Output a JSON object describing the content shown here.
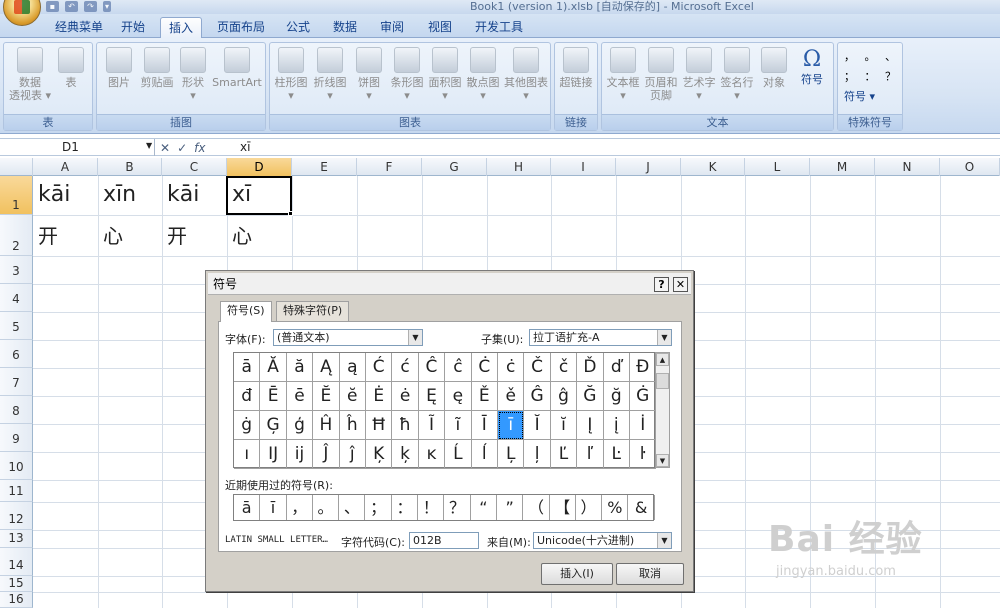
{
  "window": {
    "title": "Book1 (version 1).xlsb [自动保存的] - Microsoft Excel"
  },
  "tabs": [
    "经典菜单",
    "开始",
    "插入",
    "页面布局",
    "公式",
    "数据",
    "审阅",
    "视图",
    "开发工具"
  ],
  "active_tab": "插入",
  "ribbon": {
    "groups": [
      {
        "label": "表",
        "buttons": [
          "数据\n透视表 ▾",
          "表"
        ]
      },
      {
        "label": "插图",
        "buttons": [
          "图片",
          "剪贴画",
          "形状\n▾",
          "SmartArt"
        ]
      },
      {
        "label": "图表",
        "buttons": [
          "柱形图\n▾",
          "折线图\n▾",
          "饼图\n▾",
          "条形图\n▾",
          "面积图\n▾",
          "散点图\n▾",
          "其他图表\n▾"
        ]
      },
      {
        "label": "链接",
        "buttons": [
          "超链接"
        ]
      },
      {
        "label": "文本",
        "buttons": [
          "文本框\n▾",
          "页眉和\n页脚",
          "艺术字\n▾",
          "签名行\n▾",
          "对象",
          "符号"
        ]
      },
      {
        "label": "特殊符号",
        "buttons": [
          "，",
          "。",
          "、",
          "；",
          "：",
          "？",
          "符号 ▾"
        ]
      }
    ]
  },
  "formula_bar": {
    "name_box": "D1",
    "fx": "fx",
    "value": "xī"
  },
  "columns": [
    "A",
    "B",
    "C",
    "D",
    "E",
    "F",
    "G",
    "H",
    "I",
    "J",
    "K",
    "L",
    "M",
    "N",
    "O"
  ],
  "rows": [
    "1",
    "2",
    "3",
    "4",
    "5",
    "6",
    "7",
    "8",
    "9",
    "10",
    "11",
    "12",
    "13",
    "14",
    "15",
    "16"
  ],
  "cells": {
    "A1": "kāi",
    "B1": "xīn",
    "C1": "kāi",
    "D1": "xī",
    "A2": "开",
    "B2": "心",
    "C2": "开",
    "D2": "心"
  },
  "dialog": {
    "title": "符号",
    "help": "?",
    "close": "✕",
    "tabs": [
      "符号(S)",
      "特殊字符(P)"
    ],
    "font_label": "字体(F):",
    "font_value": "(普通文本)",
    "subset_label": "子集(U):",
    "subset_value": "拉丁语扩充-A",
    "symbols": [
      [
        "ā",
        "Ă",
        "ă",
        "Ą",
        "ą",
        "Ć",
        "ć",
        "Ĉ",
        "ĉ",
        "Ċ",
        "ċ",
        "Č",
        "č",
        "Ď",
        "ď",
        "Đ"
      ],
      [
        "đ",
        "Ē",
        "ē",
        "Ĕ",
        "ĕ",
        "Ė",
        "ė",
        "Ę",
        "ę",
        "Ě",
        "ě",
        "Ĝ",
        "ĝ",
        "Ğ",
        "ğ",
        "Ġ"
      ],
      [
        "ġ",
        "Ģ",
        "ģ",
        "Ĥ",
        "ĥ",
        "Ħ",
        "ħ",
        "Ĩ",
        "ĩ",
        "Ī",
        "ī",
        "Ĭ",
        "ĭ",
        "Į",
        "į",
        "İ"
      ],
      [
        "ı",
        "Ĳ",
        "ĳ",
        "Ĵ",
        "ĵ",
        "Ķ",
        "ķ",
        "ĸ",
        "Ĺ",
        "ĺ",
        "Ļ",
        "ļ",
        "Ľ",
        "ľ",
        "Ŀ",
        "ŀ"
      ]
    ],
    "selected_symbol": "ī",
    "recent_label": "近期使用过的符号(R):",
    "recent": [
      "ā",
      "ī",
      "，",
      "。",
      "、",
      "；",
      "：",
      "！",
      "？",
      "“",
      "”",
      "（",
      "【",
      "）",
      "%",
      "&"
    ],
    "char_name": "LATIN SMALL LETTER…",
    "code_label": "字符代码(C):",
    "code_value": "012B",
    "from_label": "来自(M):",
    "from_value": "Unicode(十六进制)",
    "insert_btn": "插入(I)",
    "cancel_btn": "取消"
  },
  "watermark": {
    "main": "Bai 经验",
    "sub": "jingyan.baidu.com"
  }
}
